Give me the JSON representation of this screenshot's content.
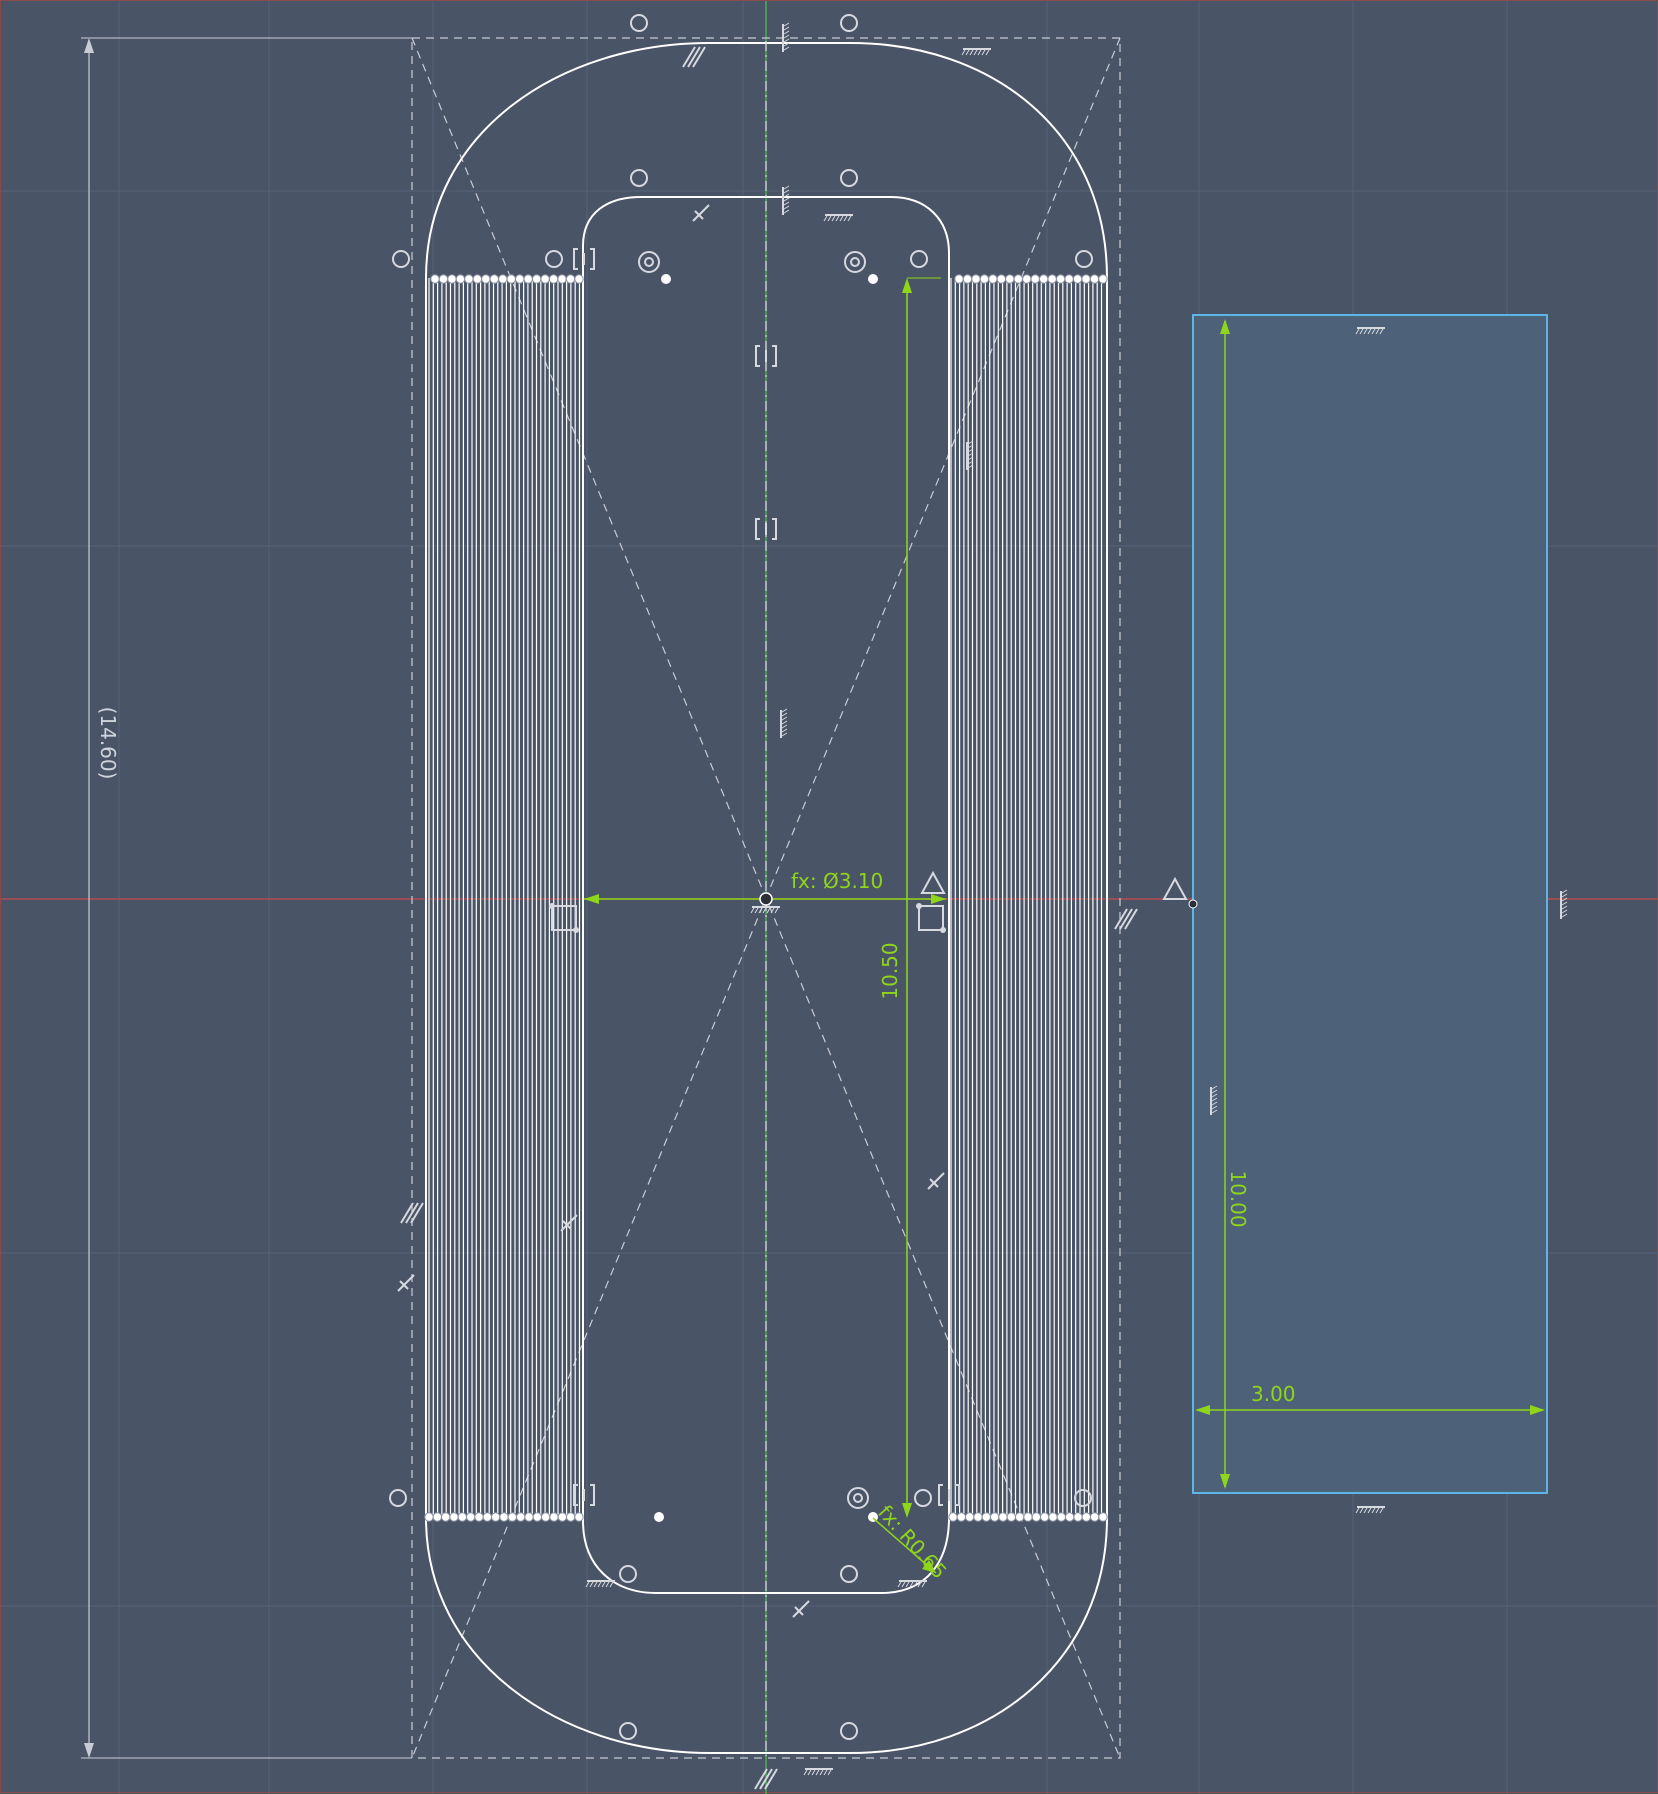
{
  "canvas": {
    "background": "#4a5467",
    "colors": {
      "sketch_line": "#ffffff",
      "construction_line": "#c8ccd4",
      "dimension": "#8fd61a",
      "selection": "#5bb6e6",
      "axis_x": "#c84a4a",
      "axis_y": "#4ec24e",
      "grid": "#58627a"
    }
  },
  "dimensions": {
    "overall_height": "(14.60)",
    "slot_diameter": "fx: Ø3.10",
    "inner_length": "10.50",
    "fillet_radius": "fx: R0.65",
    "rect_height": "10.00",
    "rect_width": "3.00"
  },
  "icons": [
    "tangent-constraint-icon",
    "horizontal-constraint-icon",
    "vertical-constraint-icon",
    "parallel-constraint-icon",
    "perpendicular-constraint-icon",
    "concentric-constraint-icon",
    "midpoint-constraint-icon",
    "coincident-constraint-icon",
    "symmetric-constraint-icon",
    "fix-constraint-icon"
  ]
}
